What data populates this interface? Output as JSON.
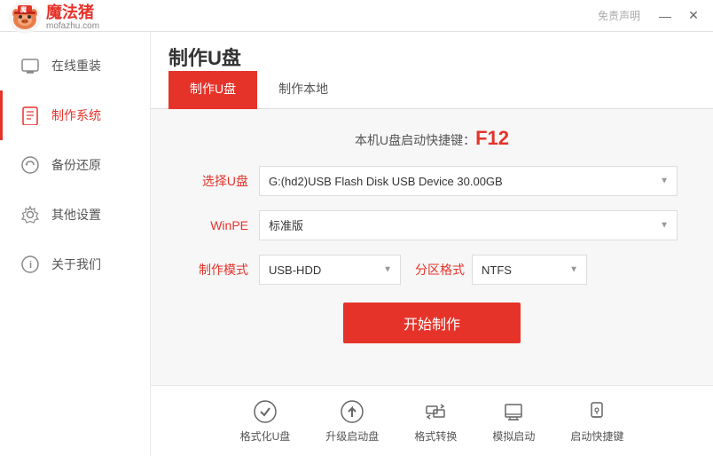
{
  "titlebar": {
    "free_label": "免责声明",
    "minimize": "—",
    "close": "✕"
  },
  "logo": {
    "site": "mofazhu.com",
    "app_name": "魔法猪"
  },
  "page_title": "制作U盘",
  "tabs": [
    {
      "label": "制作U盘",
      "active": true
    },
    {
      "label": "制作本地",
      "active": false
    }
  ],
  "shortcut": {
    "text": "本机U盘启动快捷键：",
    "key": "F12"
  },
  "form": {
    "usb_label": "选择U盘",
    "usb_value": "G:(hd2)USB Flash Disk USB Device 30.00GB",
    "winpe_label": "WinPE",
    "winpe_value": "标准版",
    "mode_label": "制作模式",
    "mode_value": "USB-HDD",
    "partition_label": "分区格式",
    "partition_value": "NTFS"
  },
  "start_button": "开始制作",
  "sidebar": {
    "items": [
      {
        "label": "在线重装",
        "icon": "🖥",
        "active": false
      },
      {
        "label": "制作系统",
        "icon": "🔒",
        "active": true
      },
      {
        "label": "备份还原",
        "icon": "⚙",
        "active": false
      },
      {
        "label": "其他设置",
        "icon": "⚙",
        "active": false
      },
      {
        "label": "关于我们",
        "icon": "ℹ",
        "active": false
      }
    ]
  },
  "toolbar": {
    "items": [
      {
        "label": "格式化U盘",
        "icon": "✓"
      },
      {
        "label": "升级启动盘",
        "icon": "↑"
      },
      {
        "label": "格式转换",
        "icon": "⇄"
      },
      {
        "label": "模拟启动",
        "icon": "⏏"
      },
      {
        "label": "启动快捷键",
        "icon": "🔒"
      }
    ]
  }
}
